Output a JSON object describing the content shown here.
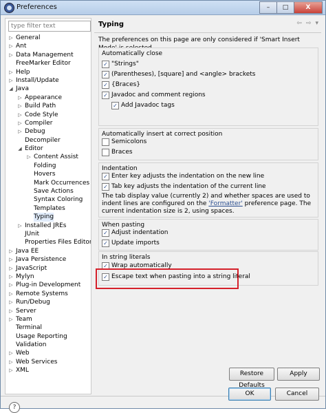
{
  "window": {
    "title": "Preferences",
    "buttons": {
      "minimize": "–",
      "maximize": "□",
      "close": "X"
    }
  },
  "filter": {
    "placeholder": "type filter text"
  },
  "tree": [
    {
      "label": "General",
      "expander": "▷",
      "indent": 0
    },
    {
      "label": "Ant",
      "expander": "▷",
      "indent": 0
    },
    {
      "label": "Data Management",
      "expander": "▷",
      "indent": 0
    },
    {
      "label": "FreeMarker Editor",
      "expander": "",
      "indent": 0
    },
    {
      "label": "Help",
      "expander": "▷",
      "indent": 0
    },
    {
      "label": "Install/Update",
      "expander": "▷",
      "indent": 0
    },
    {
      "label": "Java",
      "expander": "◢",
      "indent": 0
    },
    {
      "label": "Appearance",
      "expander": "▷",
      "indent": 1
    },
    {
      "label": "Build Path",
      "expander": "▷",
      "indent": 1
    },
    {
      "label": "Code Style",
      "expander": "▷",
      "indent": 1
    },
    {
      "label": "Compiler",
      "expander": "▷",
      "indent": 1
    },
    {
      "label": "Debug",
      "expander": "▷",
      "indent": 1
    },
    {
      "label": "Decompiler",
      "expander": "",
      "indent": 1
    },
    {
      "label": "Editor",
      "expander": "◢",
      "indent": 1
    },
    {
      "label": "Content Assist",
      "expander": "▷",
      "indent": 2
    },
    {
      "label": "Folding",
      "expander": "",
      "indent": 2
    },
    {
      "label": "Hovers",
      "expander": "",
      "indent": 2
    },
    {
      "label": "Mark Occurrences",
      "expander": "",
      "indent": 2
    },
    {
      "label": "Save Actions",
      "expander": "",
      "indent": 2
    },
    {
      "label": "Syntax Coloring",
      "expander": "",
      "indent": 2
    },
    {
      "label": "Templates",
      "expander": "",
      "indent": 2
    },
    {
      "label": "Typing",
      "expander": "",
      "indent": 2,
      "selected": true
    },
    {
      "label": "Installed JREs",
      "expander": "▷",
      "indent": 1
    },
    {
      "label": "JUnit",
      "expander": "",
      "indent": 1
    },
    {
      "label": "Properties Files Editor",
      "expander": "",
      "indent": 1
    },
    {
      "label": "Java EE",
      "expander": "▷",
      "indent": 0
    },
    {
      "label": "Java Persistence",
      "expander": "▷",
      "indent": 0
    },
    {
      "label": "JavaScript",
      "expander": "▷",
      "indent": 0
    },
    {
      "label": "Mylyn",
      "expander": "▷",
      "indent": 0
    },
    {
      "label": "Plug-in Development",
      "expander": "▷",
      "indent": 0
    },
    {
      "label": "Remote Systems",
      "expander": "▷",
      "indent": 0
    },
    {
      "label": "Run/Debug",
      "expander": "▷",
      "indent": 0
    },
    {
      "label": "Server",
      "expander": "▷",
      "indent": 0
    },
    {
      "label": "Team",
      "expander": "▷",
      "indent": 0
    },
    {
      "label": "Terminal",
      "expander": "",
      "indent": 0
    },
    {
      "label": "Usage Reporting",
      "expander": "",
      "indent": 0
    },
    {
      "label": "Validation",
      "expander": "",
      "indent": 0
    },
    {
      "label": "Web",
      "expander": "▷",
      "indent": 0
    },
    {
      "label": "Web Services",
      "expander": "▷",
      "indent": 0
    },
    {
      "label": "XML",
      "expander": "▷",
      "indent": 0
    }
  ],
  "page": {
    "title": "Typing",
    "note": "The preferences on this page are only considered if 'Smart Insert Mode' is selected.",
    "nav": {
      "back": "⇦",
      "forward": "⇨",
      "menu": "▾"
    }
  },
  "groups": {
    "auto_close": {
      "title": "Automatically close",
      "items": [
        {
          "label": "\"Strings\"",
          "checked": true
        },
        {
          "label": "(Parentheses), [square] and <angle> brackets",
          "checked": true
        },
        {
          "label": "{Braces}",
          "checked": true
        },
        {
          "label": "Javadoc and comment regions",
          "checked": true
        },
        {
          "label": "Add Javadoc tags",
          "checked": true
        }
      ]
    },
    "auto_insert": {
      "title": "Automatically insert at correct position",
      "items": [
        {
          "label": "Semicolons",
          "checked": false
        },
        {
          "label": "Braces",
          "checked": false
        }
      ]
    },
    "indentation": {
      "title": "Indentation",
      "items": [
        {
          "label": "Enter key adjusts the indentation on the new line",
          "checked": true
        },
        {
          "label": "Tab key adjusts the indentation of the current line",
          "checked": true
        }
      ],
      "para_before": "The tab display value (currently 2) and whether spaces are used to indent lines are configured on the ",
      "para_link": "'Formatter'",
      "para_after": " preference page. The current indentation size is 2, using spaces."
    },
    "pasting": {
      "title": "When pasting",
      "items": [
        {
          "label": "Adjust indentation",
          "checked": true
        },
        {
          "label": "Update imports",
          "checked": true
        }
      ]
    },
    "string_literals": {
      "title": "In string literals",
      "items": [
        {
          "label": "Wrap automatically",
          "checked": true
        },
        {
          "label": "Escape text when pasting into a string literal",
          "checked": true
        }
      ]
    }
  },
  "buttons": {
    "restore_defaults": "Restore Defaults",
    "apply": "Apply",
    "ok": "OK",
    "cancel": "Cancel",
    "help": "?"
  },
  "check_glyph": "✓",
  "colors": {
    "highlight": "#d5202a",
    "selection": "#e1ecfb"
  }
}
